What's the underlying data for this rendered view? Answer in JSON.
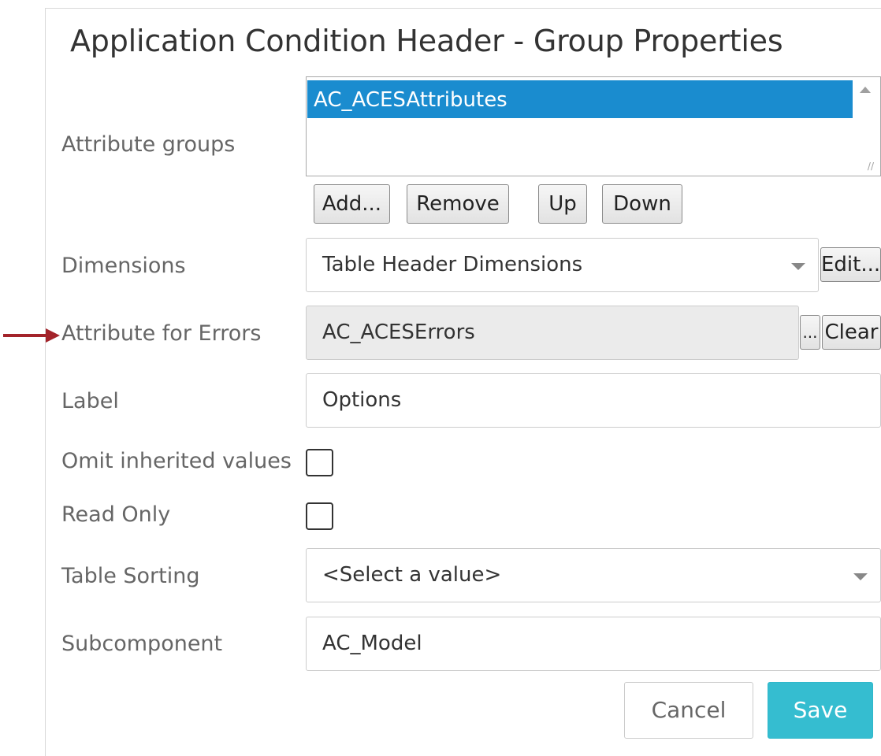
{
  "dialog": {
    "title": "Application Condition Header - Group Properties"
  },
  "attribute_groups": {
    "label": "Attribute groups",
    "items": [
      "AC_ACESAttributes"
    ],
    "selected_index": 0,
    "buttons": {
      "add": "Add...",
      "remove": "Remove",
      "up": "Up",
      "down": "Down"
    }
  },
  "dimensions": {
    "label": "Dimensions",
    "value": "Table Header Dimensions",
    "edit_button": "Edit..."
  },
  "attribute_for_errors": {
    "label": "Attribute for Errors",
    "value": "AC_ACESErrors",
    "browse_button": "...",
    "clear_button": "Clear",
    "annotation_color": "#a3232a"
  },
  "label_field": {
    "label": "Label",
    "value": "Options"
  },
  "omit_inherited": {
    "label": "Omit inherited values",
    "checked": false
  },
  "read_only": {
    "label": "Read Only",
    "checked": false
  },
  "table_sorting": {
    "label": "Table Sorting",
    "value": "<Select a value>"
  },
  "subcomponent": {
    "label": "Subcomponent",
    "value": "AC_Model"
  },
  "footer": {
    "cancel": "Cancel",
    "save": "Save"
  },
  "colors": {
    "selection": "#1a8ccf",
    "save_button": "#35bdd0",
    "label_text": "#666666"
  },
  "icons": {
    "annotation_arrow": "red-arrow-icon",
    "dropdown": "chevron-down-icon",
    "scroll_up": "scroll-up-icon",
    "resize_grip": "resize-grip-icon"
  }
}
